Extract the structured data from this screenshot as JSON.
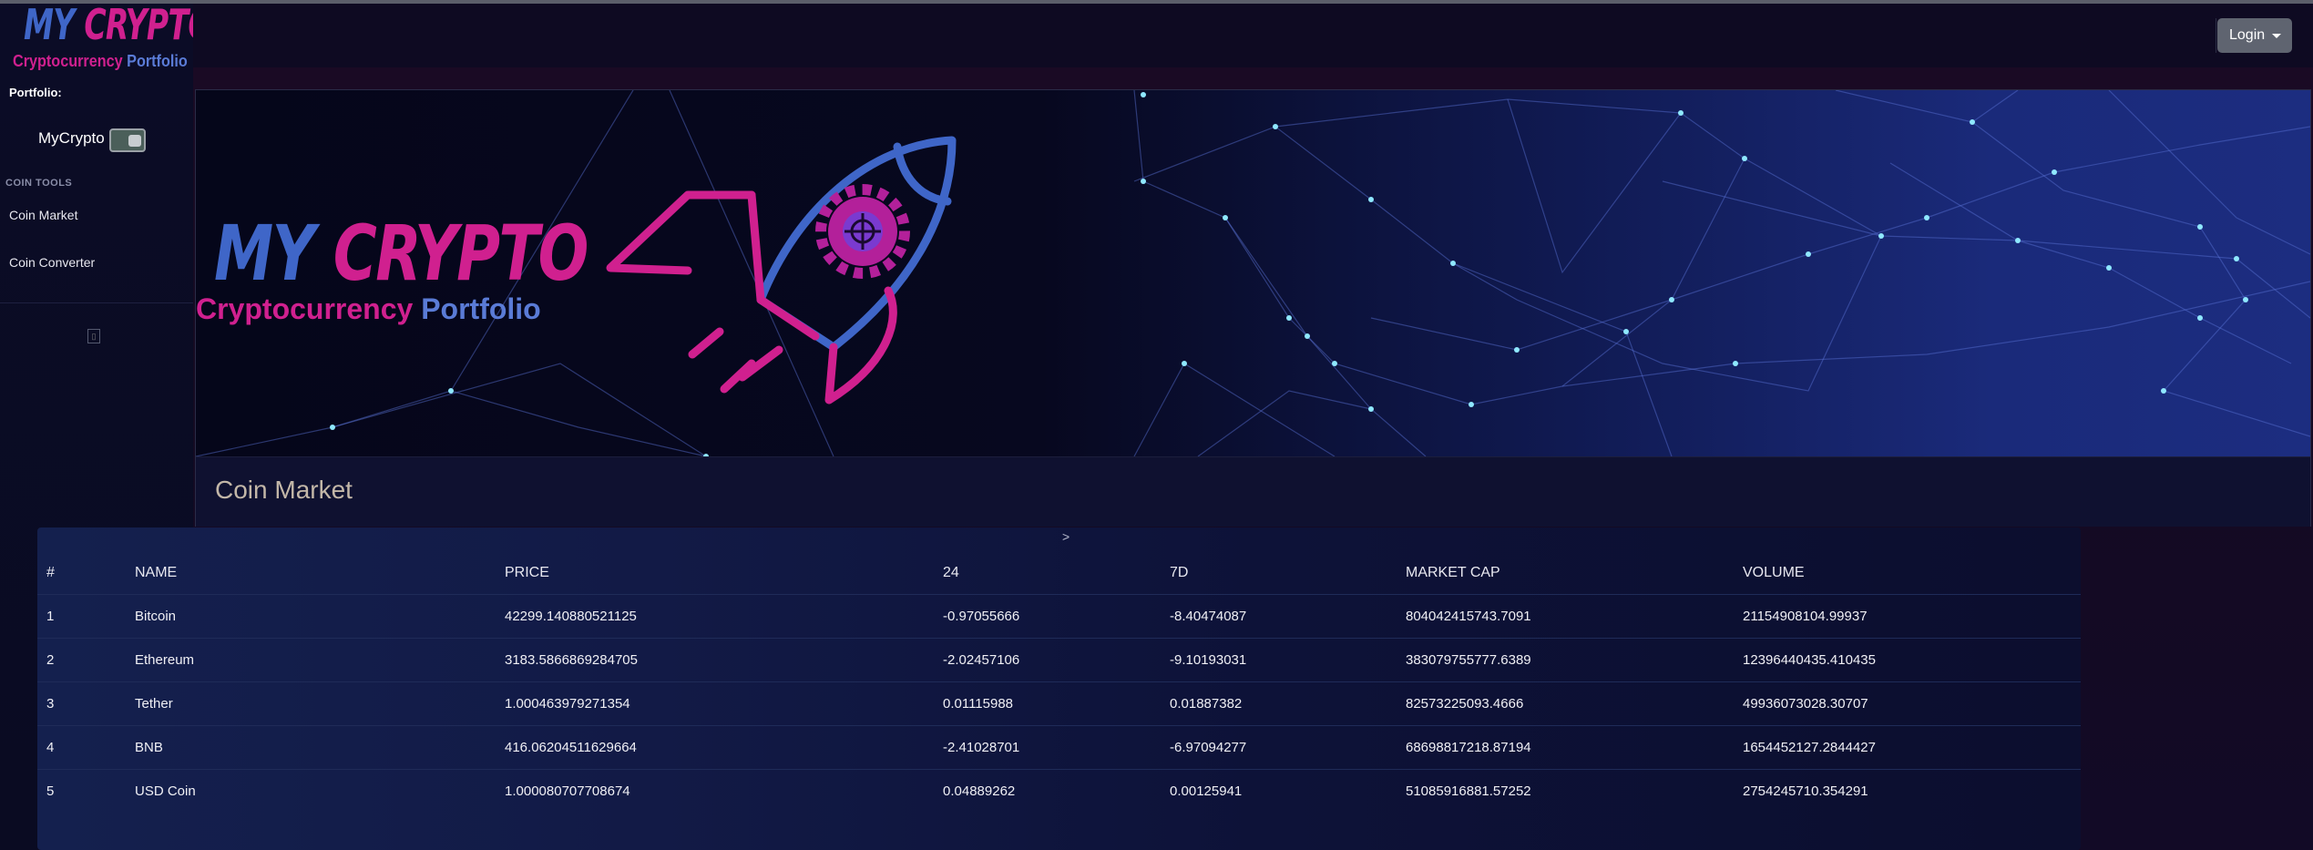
{
  "logo": {
    "title_a": "MY",
    "title_b": "CRYPTO",
    "sub_a": "Cryptocurrency",
    "sub_b": "Portfolio"
  },
  "sidebar": {
    "portfolio_label": "Portfolio:",
    "portfolio_name": "MyCrypto",
    "section_head": "COIN TOOLS",
    "items": [
      {
        "label": "Coin Market"
      },
      {
        "label": "Coin Converter"
      }
    ],
    "collapse_glyph": "▯"
  },
  "header": {
    "login_label": "Login"
  },
  "banner": {
    "title_a": "MY",
    "title_b": "CRYPTO",
    "sub_a": "Cryptocurrency",
    "sub_b": "Portfolio"
  },
  "page": {
    "title": "Coin Market",
    "scroll_hint": ">"
  },
  "table": {
    "columns": [
      "#",
      "NAME",
      "PRICE",
      "24",
      "7D",
      "MARKET CAP",
      "VOLUME"
    ],
    "rows": [
      [
        "1",
        "Bitcoin",
        "42299.140880521125",
        "-0.97055666",
        "-8.40474087",
        "804042415743.7091",
        "21154908104.99937"
      ],
      [
        "2",
        "Ethereum",
        "3183.5866869284705",
        "-2.02457106",
        "-9.10193031",
        "383079755777.6389",
        "12396440435.410435"
      ],
      [
        "3",
        "Tether",
        "1.000463979271354",
        "0.01115988",
        "0.01887382",
        "82573225093.4666",
        "49936073028.30707"
      ],
      [
        "4",
        "BNB",
        "416.06204511629664",
        "-2.41028701",
        "-6.97094277",
        "68698817218.87194",
        "1654452127.2844427"
      ],
      [
        "5",
        "USD Coin",
        "1.000080707708674",
        "0.04889262",
        "0.00125941",
        "51085916881.57252",
        "2754245710.354291"
      ]
    ]
  },
  "colors": {
    "accent_pink": "#d0208f",
    "accent_blue": "#3f66c8",
    "login_bg": "#5f6470"
  }
}
